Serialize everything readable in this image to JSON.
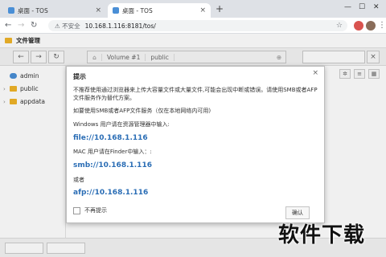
{
  "browser": {
    "tabs": [
      {
        "title": "桌面 - TOS",
        "active": false
      },
      {
        "title": "桌面 - TOS",
        "active": true
      }
    ],
    "new_tab": "+",
    "window_controls": {
      "minimize": "—",
      "maximize": "☐",
      "close": "✕"
    },
    "address": {
      "security": "⚠ 不安全",
      "url": "10.168.1.116:8181/tos/"
    }
  },
  "app": {
    "title": "文件管理",
    "breadcrumb": [
      "Volume #1",
      "public"
    ],
    "sidebar_items": [
      {
        "label": "admin",
        "icon": "user-icon"
      },
      {
        "label": "public",
        "icon": "folder-icon"
      },
      {
        "label": "appdata",
        "icon": "folder-icon"
      }
    ]
  },
  "dialog": {
    "title": "提示",
    "close": "×",
    "warning": "不推荐使用通过浏览器来上传大容量文件或大量文件,可能会出现中断或错误。请使用SMB或者AFP文件服务作为替代方案。",
    "hint": "如要使用SMB或者AFP文件服务（仅在本地网络内可用)",
    "windows_label": "Windows 用户请在资源管理器中输入:",
    "windows_link": "file://10.168.1.116",
    "mac_label": "MAC 用户请在Finder中输入：:",
    "mac_link": "smb://10.168.1.116",
    "or_label": "或者",
    "afp_link": "afp://10.168.1.116",
    "dont_show": "不再提示",
    "ok_button": "确认"
  },
  "watermark": "软件下载",
  "colors": {
    "link": "#2a6db5",
    "folder": "#f0b429",
    "accent": "#4a8fd6"
  }
}
